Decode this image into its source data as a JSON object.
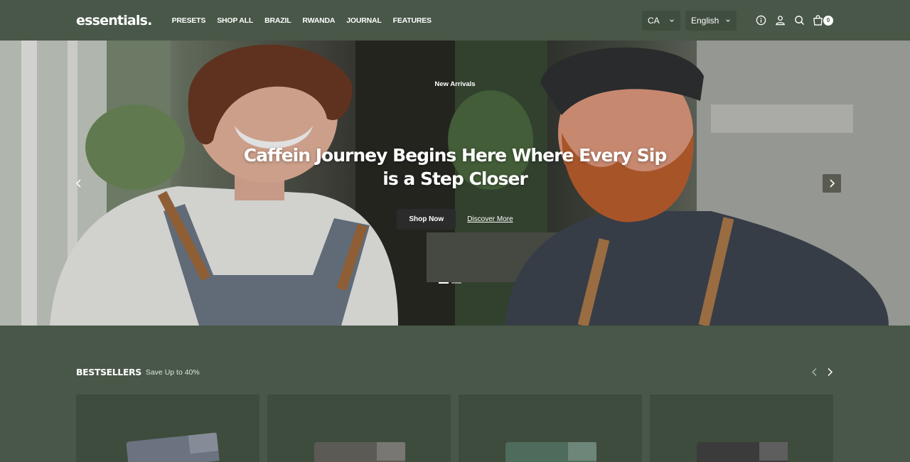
{
  "header": {
    "logo": "essentials.",
    "nav": [
      "PRESETS",
      "SHOP ALL",
      "BRAZIL",
      "RWANDA",
      "JOURNAL",
      "FEATURES"
    ],
    "country": "CA",
    "language": "English",
    "cart_count": "0"
  },
  "hero": {
    "eyebrow": "New Arrivals",
    "title": "Caffein Journey Begins Here Where Every Sip is a Step Closer",
    "primary_cta": "Shop Now",
    "secondary_cta": "Discover More",
    "slide_count": 2,
    "active_slide": 1
  },
  "bestsellers": {
    "title": "BESTSELLERS",
    "subtitle": "Save Up to 40%"
  },
  "colors": {
    "background": "#485747",
    "card": "#3e4c3d",
    "button_dark": "#2a2b2a",
    "text": "#ffffff"
  },
  "icons": [
    "info-icon",
    "account-icon",
    "search-icon",
    "cart-icon",
    "chevron-down-icon",
    "chevron-left-icon",
    "chevron-right-icon"
  ]
}
